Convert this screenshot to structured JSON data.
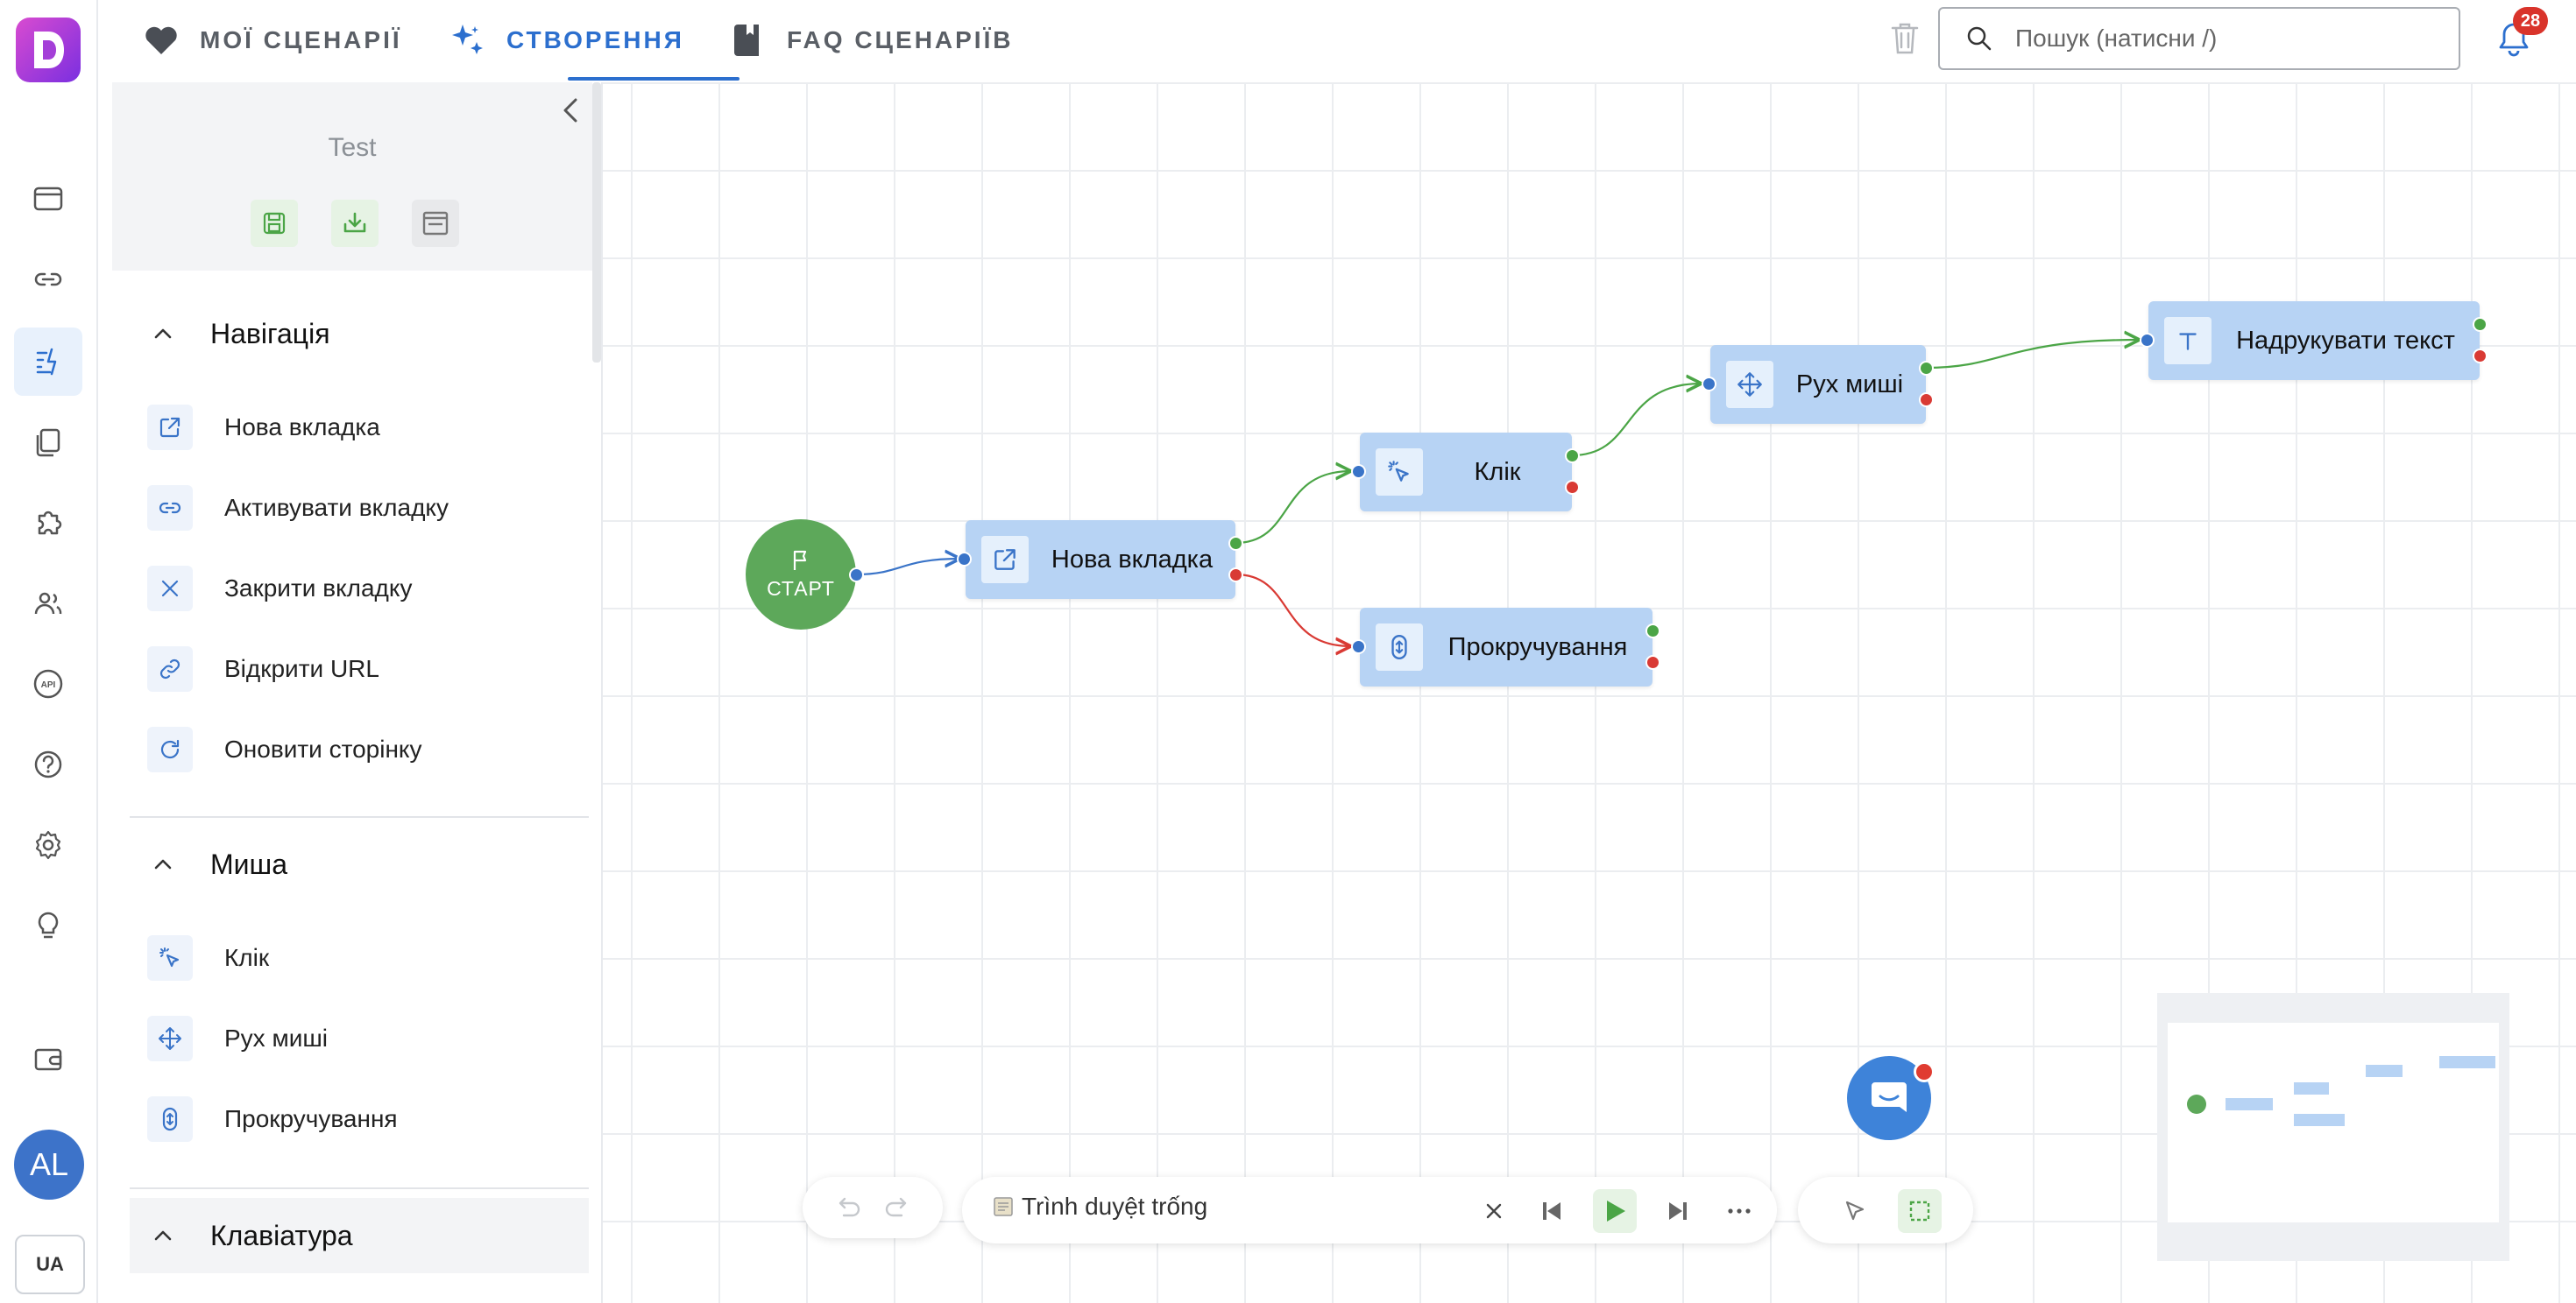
{
  "topbar": {
    "tabs": [
      {
        "label": "МОЇ СЦЕНАРІЇ"
      },
      {
        "label": "СТВОРЕННЯ"
      },
      {
        "label": "FAQ СЦЕНАРІЇВ"
      }
    ],
    "search_placeholder": "Пошук (натисни /)",
    "notifications_count": "28"
  },
  "rail": {
    "avatar_initials": "AL",
    "language": "UA"
  },
  "panel": {
    "scenario_name": "Test",
    "sections": [
      {
        "title": "Навігація",
        "items": [
          {
            "label": "Нова вкладка",
            "icon": "open-tab-icon"
          },
          {
            "label": "Активувати вкладку",
            "icon": "link-icon"
          },
          {
            "label": "Закрити вкладку",
            "icon": "close-icon"
          },
          {
            "label": "Відкрити URL",
            "icon": "url-icon"
          },
          {
            "label": "Оновити сторінку",
            "icon": "refresh-icon"
          }
        ]
      },
      {
        "title": "Миша",
        "items": [
          {
            "label": "Клік",
            "icon": "click-icon"
          },
          {
            "label": "Рух миші",
            "icon": "move-icon"
          },
          {
            "label": "Прокручування",
            "icon": "scroll-icon"
          }
        ]
      },
      {
        "title": "Клавіатура",
        "items": []
      }
    ]
  },
  "canvas": {
    "start_label": "СТАРТ",
    "nodes": [
      {
        "label": "Нова вкладка",
        "icon": "open-tab-icon"
      },
      {
        "label": "Клік",
        "icon": "click-icon"
      },
      {
        "label": "Прокручування",
        "icon": "scroll-icon"
      },
      {
        "label": "Рух миші",
        "icon": "move-icon"
      },
      {
        "label": "Надрукувати текст",
        "icon": "text-icon"
      }
    ]
  },
  "toolbar": {
    "browser_label": "Trình duyệt trống"
  },
  "colors": {
    "accent": "#2c6fce",
    "node": "#b7d3f4",
    "start": "#5da85a",
    "success_port": "#4ba546",
    "error_port": "#d93a34"
  }
}
